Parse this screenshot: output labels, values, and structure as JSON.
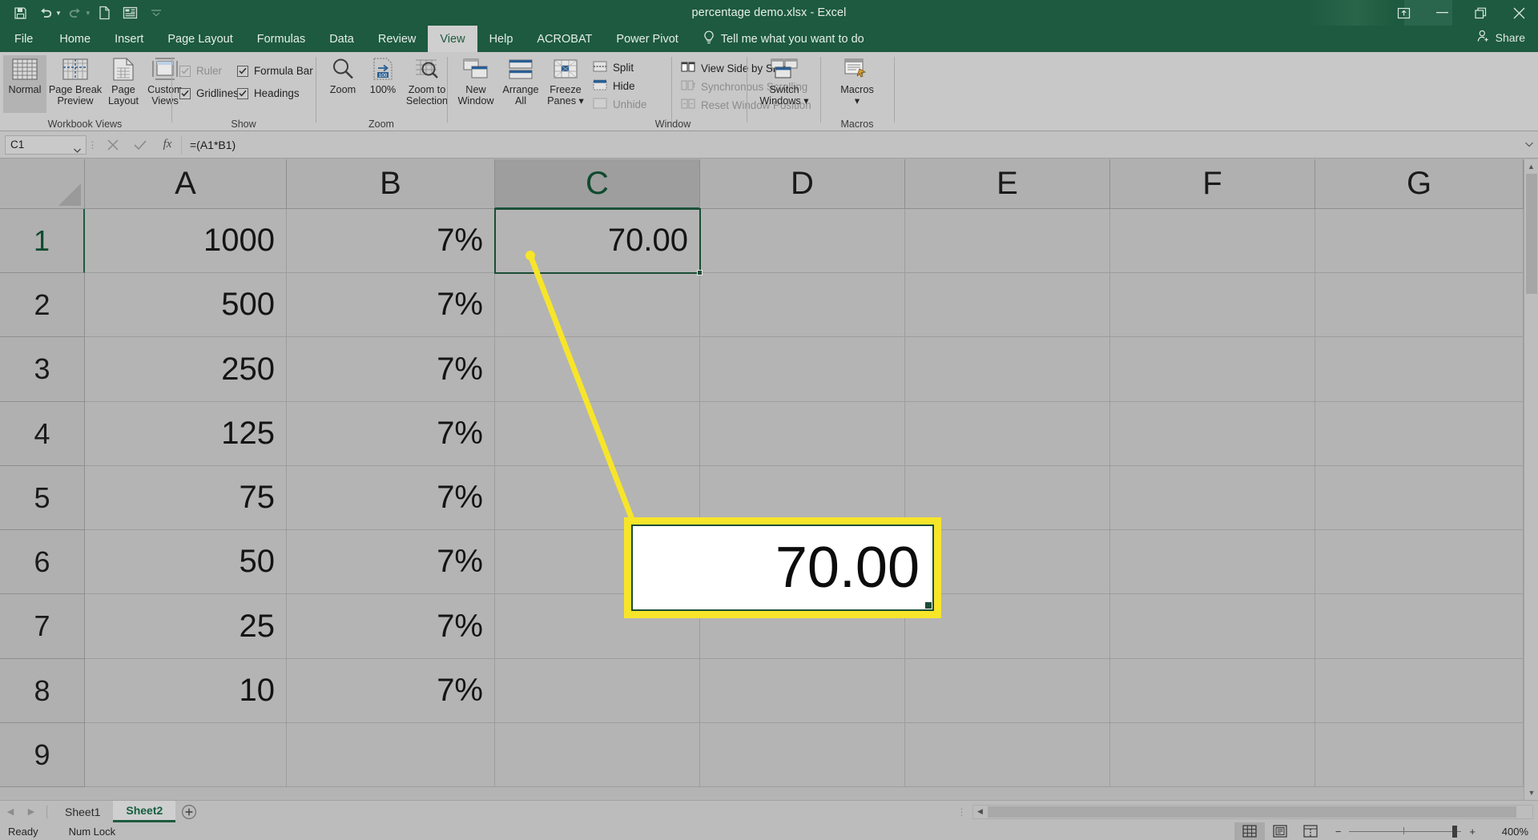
{
  "titlebar": {
    "document_title": "percentage demo.xlsx  -  Excel",
    "quick_access": [
      {
        "name": "save-icon",
        "label": "Save"
      },
      {
        "name": "undo-icon",
        "label": "Undo"
      },
      {
        "name": "redo-icon",
        "label": "Redo"
      },
      {
        "name": "new-icon",
        "label": "New"
      },
      {
        "name": "touch-mode-icon",
        "label": "Touch/Mouse Mode"
      },
      {
        "name": "customize-qat-icon",
        "label": "Customize Quick Access Toolbar"
      }
    ],
    "window_controls": [
      {
        "name": "ribbon-display-options-icon",
        "label": "Ribbon Display Options"
      },
      {
        "name": "minimize-icon",
        "label": "Minimize"
      },
      {
        "name": "restore-icon",
        "label": "Restore Down"
      },
      {
        "name": "close-icon",
        "label": "Close"
      }
    ]
  },
  "tabs": {
    "items": [
      "File",
      "Home",
      "Insert",
      "Page Layout",
      "Formulas",
      "Data",
      "Review",
      "View",
      "Help",
      "ACROBAT",
      "Power Pivot"
    ],
    "active": "View",
    "tell_me": "Tell me what you want to do",
    "share_label": "Share"
  },
  "ribbon": {
    "groups": [
      {
        "label": "Workbook Views",
        "buttons": [
          {
            "name": "normal-view-button",
            "line1": "Normal",
            "line2": "",
            "selected": true
          },
          {
            "name": "page-break-preview-button",
            "line1": "Page Break",
            "line2": "Preview",
            "selected": false
          },
          {
            "name": "page-layout-button",
            "line1": "Page",
            "line2": "Layout",
            "selected": false
          },
          {
            "name": "custom-views-button",
            "line1": "Custom",
            "line2": "Views",
            "selected": false
          }
        ]
      },
      {
        "label": "Show",
        "checkboxes": [
          {
            "name": "ruler-checkbox",
            "label": "Ruler",
            "checked": true,
            "disabled": true
          },
          {
            "name": "formula-bar-checkbox",
            "label": "Formula Bar",
            "checked": true,
            "disabled": false
          },
          {
            "name": "gridlines-checkbox",
            "label": "Gridlines",
            "checked": true,
            "disabled": false
          },
          {
            "name": "headings-checkbox",
            "label": "Headings",
            "checked": true,
            "disabled": false
          }
        ]
      },
      {
        "label": "Zoom",
        "buttons": [
          {
            "name": "zoom-button",
            "line1": "Zoom",
            "line2": "",
            "selected": false
          },
          {
            "name": "zoom-100-button",
            "line1": "100%",
            "line2": "",
            "selected": false
          },
          {
            "name": "zoom-to-selection-button",
            "line1": "Zoom to",
            "line2": "Selection",
            "selected": false
          }
        ]
      },
      {
        "label": "Window",
        "buttons": [
          {
            "name": "new-window-button",
            "line1": "New",
            "line2": "Window",
            "selected": false
          },
          {
            "name": "arrange-all-button",
            "line1": "Arrange",
            "line2": "All",
            "selected": false
          },
          {
            "name": "freeze-panes-button",
            "line1": "Freeze",
            "line2": "Panes ▾",
            "selected": false
          }
        ],
        "commands": [
          {
            "name": "split-command",
            "label": "Split",
            "disabled": false
          },
          {
            "name": "hide-command",
            "label": "Hide",
            "disabled": false
          },
          {
            "name": "unhide-command",
            "label": "Unhide",
            "disabled": true
          },
          {
            "name": "view-side-by-side-command",
            "label": "View Side by Side",
            "disabled": false
          },
          {
            "name": "synchronous-scrolling-command",
            "label": "Synchronous Scrolling",
            "disabled": true
          },
          {
            "name": "reset-window-position-command",
            "label": "Reset Window Position",
            "disabled": true
          }
        ]
      },
      {
        "label": "Macros",
        "buttons": [
          {
            "name": "switch-windows-button",
            "line1": "Switch",
            "line2": "Windows ▾",
            "selected": false
          },
          {
            "name": "macros-button",
            "line1": "Macros",
            "line2": "▾",
            "selected": false
          }
        ]
      }
    ]
  },
  "formula_bar": {
    "name_box_value": "C1",
    "cancel_label": "✕",
    "enter_label": "✓",
    "function_label": "fx",
    "formula_value": "=(A1*B1)"
  },
  "grid": {
    "columns": [
      "A",
      "B",
      "C",
      "D",
      "E",
      "F",
      "G"
    ],
    "selected_column": "C",
    "rows": [
      "1",
      "2",
      "3",
      "4",
      "5",
      "6",
      "7",
      "8",
      "9"
    ],
    "selected_row": "1",
    "data": [
      {
        "row": "1",
        "A": "1000",
        "B": "7%",
        "C": "70.00",
        "D": "",
        "E": "",
        "F": "",
        "G": ""
      },
      {
        "row": "2",
        "A": "500",
        "B": "7%",
        "C": "",
        "D": "",
        "E": "",
        "F": "",
        "G": ""
      },
      {
        "row": "3",
        "A": "250",
        "B": "7%",
        "C": "",
        "D": "",
        "E": "",
        "F": "",
        "G": ""
      },
      {
        "row": "4",
        "A": "125",
        "B": "7%",
        "C": "",
        "D": "",
        "E": "",
        "F": "",
        "G": ""
      },
      {
        "row": "5",
        "A": "75",
        "B": "7%",
        "C": "",
        "D": "",
        "E": "",
        "F": "",
        "G": ""
      },
      {
        "row": "6",
        "A": "50",
        "B": "7%",
        "C": "",
        "D": "",
        "E": "",
        "F": "",
        "G": ""
      },
      {
        "row": "7",
        "A": "25",
        "B": "7%",
        "C": "",
        "D": "",
        "E": "",
        "F": "",
        "G": ""
      },
      {
        "row": "8",
        "A": "10",
        "B": "7%",
        "C": "",
        "D": "",
        "E": "",
        "F": "",
        "G": ""
      },
      {
        "row": "9",
        "A": "",
        "B": "",
        "C": "",
        "D": "",
        "E": "",
        "F": "",
        "G": ""
      }
    ],
    "active_cell": "C1"
  },
  "callout": {
    "value": "70.00",
    "border_color": "#f7e52a",
    "inner_border_color": "#1a4d35",
    "background": "#ffffff"
  },
  "sheet_tabs": {
    "items": [
      {
        "name": "sheet-tab-sheet1",
        "label": "Sheet1",
        "active": false
      },
      {
        "name": "sheet-tab-sheet2",
        "label": "Sheet2",
        "active": true
      }
    ],
    "add_label": "+"
  },
  "status_bar": {
    "mode": "Ready",
    "num_lock": "Num Lock",
    "views": [
      {
        "name": "normal-view-icon",
        "label": "Normal",
        "active": true
      },
      {
        "name": "page-layout-view-icon",
        "label": "Page Layout",
        "active": false
      },
      {
        "name": "page-break-preview-icon",
        "label": "Page Break Preview",
        "active": false
      }
    ],
    "zoom_out_label": "−",
    "zoom_in_label": "+",
    "zoom_level": "400%"
  },
  "colors": {
    "excel_green": "#1d5a3f",
    "selection_green": "#1a4d35",
    "callout_yellow": "#f7e52a"
  }
}
